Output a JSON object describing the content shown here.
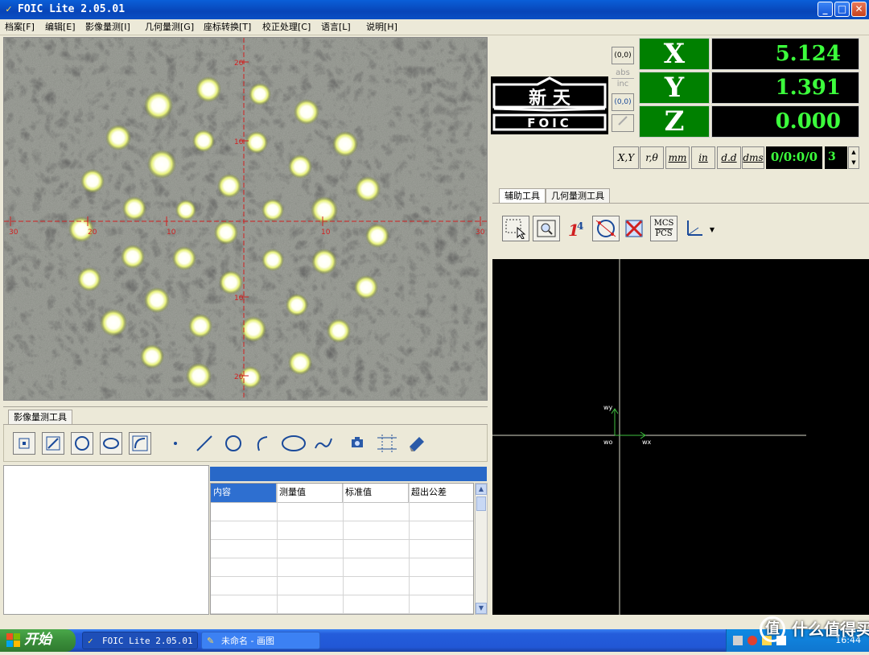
{
  "window": {
    "title": "FOIC Lite 2.05.01"
  },
  "menu": [
    "档案[F]",
    "编辑[E]",
    "影像量测[I]",
    "几何量测[G]",
    "座标转换[T]",
    "校正处理[C]",
    "语言[L]",
    "说明[H]"
  ],
  "logo": {
    "chinese": "新 天",
    "brand": "FOIC"
  },
  "coordinates": {
    "x": {
      "label": "X",
      "value": "5.124"
    },
    "y": {
      "label": "Y",
      "value": "1.391"
    },
    "z": {
      "label": "Z",
      "value": "0.000"
    }
  },
  "coord_buttons": [
    "(0,0)",
    "abs",
    "inc",
    "(0,0)"
  ],
  "unit_buttons": [
    "X,Y",
    "r,θ",
    "mm",
    "in",
    "d.d",
    "dms"
  ],
  "readout": "0/0:0/0",
  "spin_value": "3",
  "right_tabs": [
    "辅助工具",
    "几何量测工具"
  ],
  "mcs_pcs": [
    "MCS",
    "PCS"
  ],
  "image_tool_tab": "影像量测工具",
  "crosshair_labels": {
    "left": "30",
    "left_inner": "20",
    "mid_left": "10",
    "mid_right": "10",
    "right": "30",
    "top": "20",
    "upper": "10",
    "lower": "10",
    "bottom": "20"
  },
  "results_table": {
    "columns": [
      "内容",
      "测量值",
      "标准值",
      "超出公差"
    ],
    "rows": 6
  },
  "graph": {
    "wy": "wy",
    "wo": "wo",
    "wx": "wx"
  },
  "taskbar": {
    "start": "开始",
    "tasks": [
      "FOIC Lite 2.05.01",
      "未命名 - 画图"
    ],
    "clock": "16:44"
  },
  "watermark": "什么值得买",
  "colors": {
    "readout_green": "#3cff3c",
    "axis_label_bg": "#008000",
    "crosshair": "#d02020"
  }
}
